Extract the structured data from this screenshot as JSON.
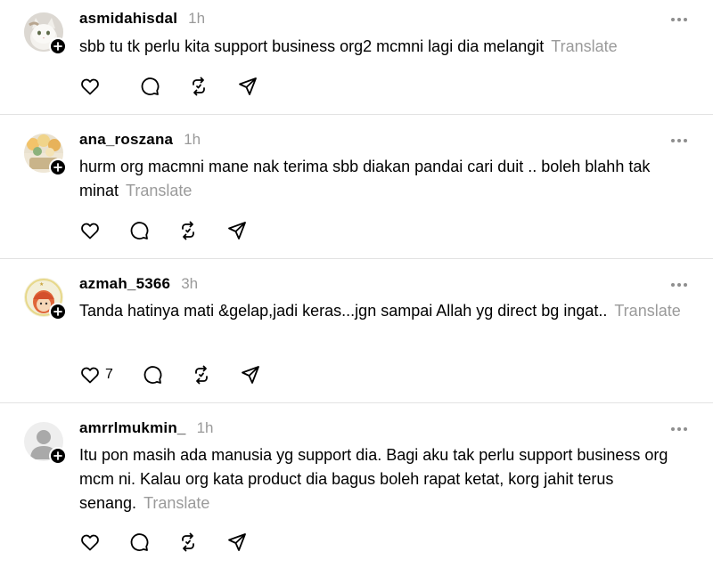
{
  "posts": [
    {
      "username": "asmidahisdal",
      "time": "1h",
      "text": "sbb tu tk perlu kita support business org2 mcmni lagi dia melangit",
      "translate": "Translate",
      "likes": ""
    },
    {
      "username": "ana_roszana",
      "time": "1h",
      "text": "hurm org macmni mane nak terima sbb diakan pandai cari duit .. boleh blahh tak minat",
      "translate": "Translate",
      "likes": ""
    },
    {
      "username": "azmah_5366",
      "time": "3h",
      "text": "Tanda hatinya mati &gelap,jadi keras...jgn sampai Allah yg direct bg ingat..",
      "translate": "Translate",
      "likes": "7"
    },
    {
      "username": "amrrlmukmin_",
      "time": "1h",
      "text": "Itu pon masih ada manusia yg support dia. Bagi aku tak perlu support business org mcm ni. Kalau org kata product dia bagus boleh rapat ketat, korg jahit terus senang.",
      "translate": "Translate",
      "likes": ""
    }
  ],
  "icons": {
    "like": "heart-icon",
    "comment": "comment-bubble-icon",
    "repost": "repost-icon",
    "share": "send-icon",
    "more": "more-options-icon",
    "follow": "plus-icon"
  }
}
